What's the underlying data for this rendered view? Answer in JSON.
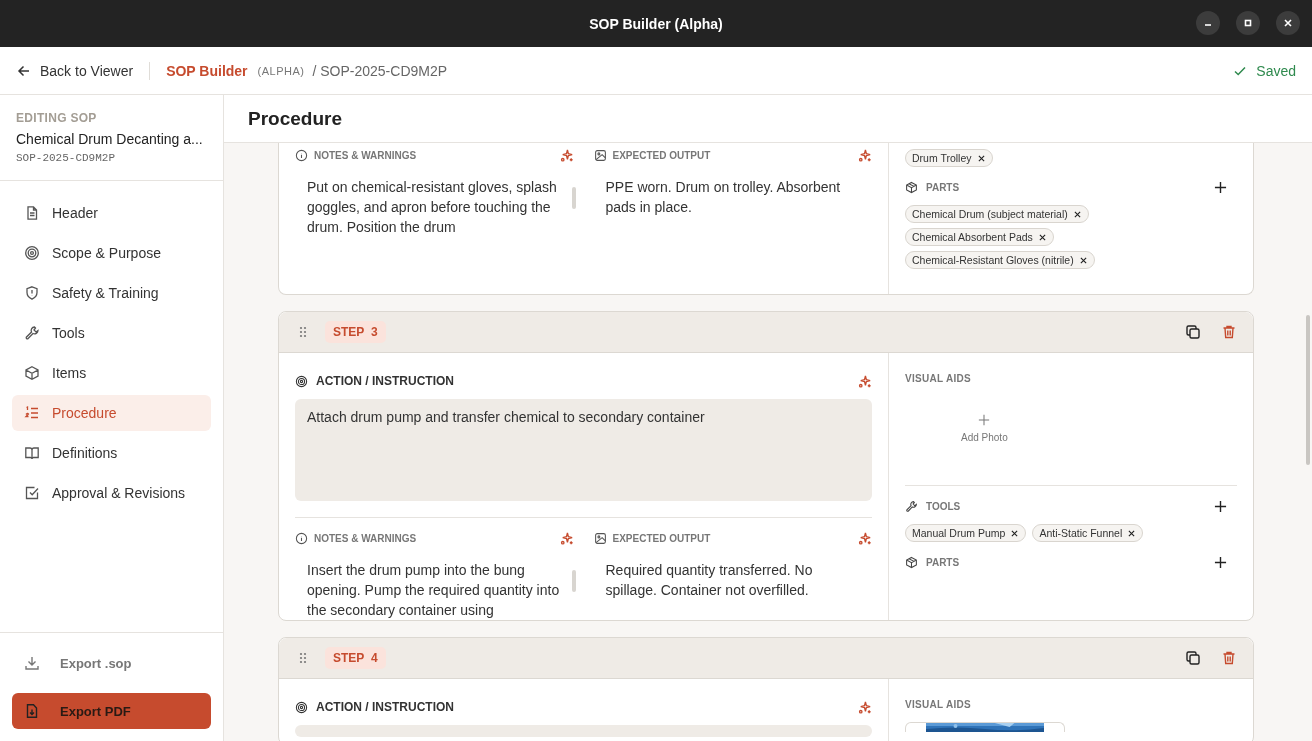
{
  "window": {
    "title": "SOP Builder (Alpha)"
  },
  "topbar": {
    "back_label": "Back to Viewer",
    "brand": "SOP Builder",
    "brand_tag": "(ALPHA)",
    "breadcrumb": "/ SOP-2025-CD9M2P",
    "status": "Saved"
  },
  "sidebar": {
    "caption": "EDITING SOP",
    "sop_title": "Chemical Drum Decanting a...",
    "sop_id": "SOP-2025-CD9M2P",
    "items": [
      {
        "label": "Header",
        "kind": "document",
        "selected": false
      },
      {
        "label": "Scope & Purpose",
        "kind": "target",
        "selected": false
      },
      {
        "label": "Safety & Training",
        "kind": "shield",
        "selected": false
      },
      {
        "label": "Tools",
        "kind": "wrench",
        "selected": false
      },
      {
        "label": "Items",
        "kind": "box",
        "selected": false
      },
      {
        "label": "Procedure",
        "kind": "list",
        "selected": true
      },
      {
        "label": "Definitions",
        "kind": "book",
        "selected": false
      },
      {
        "label": "Approval & Revisions",
        "kind": "check",
        "selected": false
      }
    ],
    "export_sop": "Export .sop",
    "export_pdf": "Export PDF"
  },
  "main": {
    "title": "Procedure",
    "steps": [
      {
        "kind": "tail",
        "notes_label": "NOTES & WARNINGS",
        "notes_text": "Put on chemical-resistant gloves, splash goggles, and apron before touching the drum. Position the drum",
        "output_label": "EXPECTED OUTPUT",
        "output_text": "PPE worn. Drum on trolley. Absorbent pads in place.",
        "tool_chips": [
          "Drum Trolley"
        ],
        "parts_label": "PARTS",
        "part_chips": [
          "Chemical Drum (subject material)",
          "Chemical Absorbent Pads",
          "Chemical-Resistant Gloves (nitrile)"
        ]
      },
      {
        "kind": "full",
        "step_label": "STEP",
        "number": "3",
        "action_label": "ACTION / INSTRUCTION",
        "action_text": "Attach drum pump and transfer chemical to secondary container",
        "notes_label": "NOTES & WARNINGS",
        "notes_text": "Insert the drum pump into the bung opening. Pump the required quantity into the secondary container using",
        "output_label": "EXPECTED OUTPUT",
        "output_text": "Required quantity transferred. No spillage. Container not overfilled.",
        "visual_aids_label": "VISUAL AIDS",
        "add_photo_label": "Add Photo",
        "tools_label": "TOOLS",
        "tool_chips": [
          "Manual Drum Pump",
          "Anti-Static Funnel"
        ],
        "parts_label": "PARTS"
      },
      {
        "kind": "head",
        "step_label": "STEP",
        "number": "4",
        "action_label": "ACTION / INSTRUCTION",
        "visual_aids_label": "VISUAL AIDS"
      }
    ]
  }
}
